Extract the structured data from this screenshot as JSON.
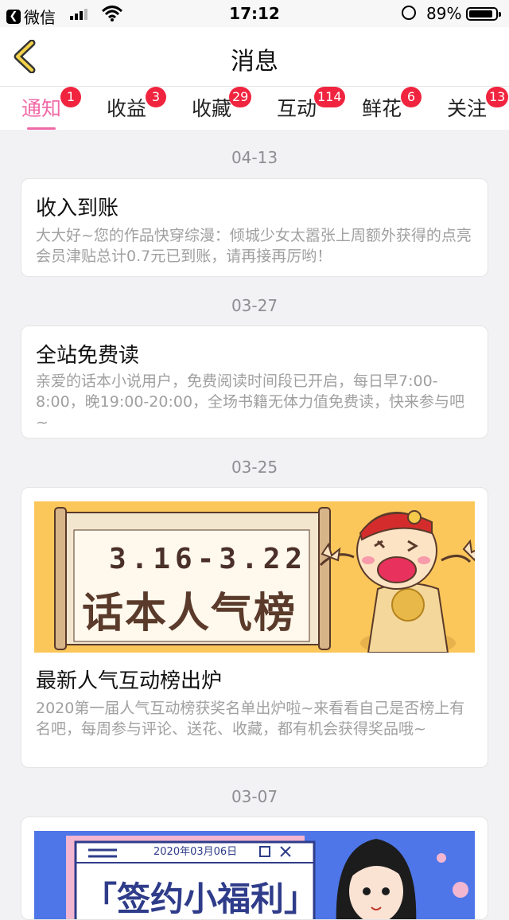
{
  "status_bar": {
    "back_app": "微信",
    "time": "17:12",
    "battery": "89%"
  },
  "nav": {
    "title": "消息"
  },
  "tabs": [
    {
      "label": "通知",
      "badge": "1"
    },
    {
      "label": "收益",
      "badge": "3"
    },
    {
      "label": "收藏",
      "badge": "29"
    },
    {
      "label": "互动",
      "badge": "114"
    },
    {
      "label": "鲜花",
      "badge": "6"
    },
    {
      "label": "关注",
      "badge": "13"
    }
  ],
  "messages": [
    {
      "date": "04-13",
      "title": "收入到账",
      "body": "大大好~您的作品快穿综漫：倾城少女太嚣张上周额外获得的点亮会员津贴总计0.7元已到账，请再接再厉哟！"
    },
    {
      "date": "03-27",
      "title": "全站免费读",
      "body": "亲爱的话本小说用户，免费阅读时间段已开启，每日早7:00-8:00，晚19:00-20:00，全场书籍无体力值免费读，快来参与吧~"
    },
    {
      "date": "03-25",
      "banner": {
        "line1": "3.16-3.22",
        "line2": "话本人气榜"
      },
      "title": "最新人气互动榜出炉",
      "body": "2020第一届人气互动榜获奖名单出炉啦~来看看自己是否榜上有名吧，每周参与评论、送花、收藏，都有机会获得奖品哦~"
    },
    {
      "date": "03-07",
      "banner": {
        "date": "2020年03月06日",
        "text": "「签约小福利」"
      }
    }
  ],
  "colors": {
    "accent": "#f06aa7",
    "badge": "#f0243f",
    "banner_yellow": "#fbc75a",
    "banner_blue": "#4e76e8"
  }
}
